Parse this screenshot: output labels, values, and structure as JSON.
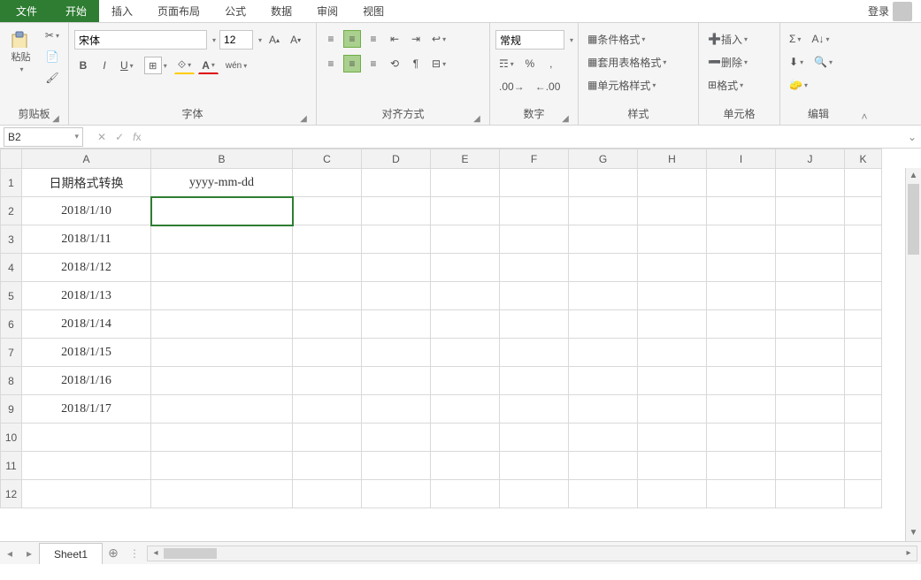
{
  "menu": {
    "file": "文件",
    "tabs": [
      "开始",
      "插入",
      "页面布局",
      "公式",
      "数据",
      "审阅",
      "视图"
    ],
    "active": 0,
    "login": "登录"
  },
  "ribbon": {
    "clipboard": {
      "paste": "粘贴",
      "label": "剪贴板"
    },
    "font": {
      "name": "宋体",
      "size": "12",
      "bold": "B",
      "italic": "I",
      "underline": "U",
      "label": "字体",
      "wen": "wén"
    },
    "align": {
      "label": "对齐方式"
    },
    "number": {
      "format": "常规",
      "label": "数字"
    },
    "styles": {
      "cond": "条件格式",
      "tbl": "套用表格格式",
      "cell": "单元格样式",
      "label": "样式"
    },
    "cells": {
      "ins": "插入",
      "del": "删除",
      "fmt": "格式",
      "label": "单元格"
    },
    "editing": {
      "label": "编辑"
    }
  },
  "namebox": "B2",
  "formula": "",
  "columns": [
    "A",
    "B",
    "C",
    "D",
    "E",
    "F",
    "G",
    "H",
    "I",
    "J",
    "K"
  ],
  "rows": [
    {
      "n": "1",
      "A": "日期格式转换",
      "B": "yyyy-mm-dd"
    },
    {
      "n": "2",
      "A": "2018/1/10",
      "B": ""
    },
    {
      "n": "3",
      "A": "2018/1/11",
      "B": ""
    },
    {
      "n": "4",
      "A": "2018/1/12",
      "B": ""
    },
    {
      "n": "5",
      "A": "2018/1/13",
      "B": ""
    },
    {
      "n": "6",
      "A": "2018/1/14",
      "B": ""
    },
    {
      "n": "7",
      "A": "2018/1/15",
      "B": ""
    },
    {
      "n": "8",
      "A": "2018/1/16",
      "B": ""
    },
    {
      "n": "9",
      "A": "2018/1/17",
      "B": ""
    },
    {
      "n": "10",
      "A": "",
      "B": ""
    },
    {
      "n": "11",
      "A": "",
      "B": ""
    },
    {
      "n": "12",
      "A": "",
      "B": ""
    }
  ],
  "selected_cell": "B2",
  "sheet_tab": "Sheet1"
}
